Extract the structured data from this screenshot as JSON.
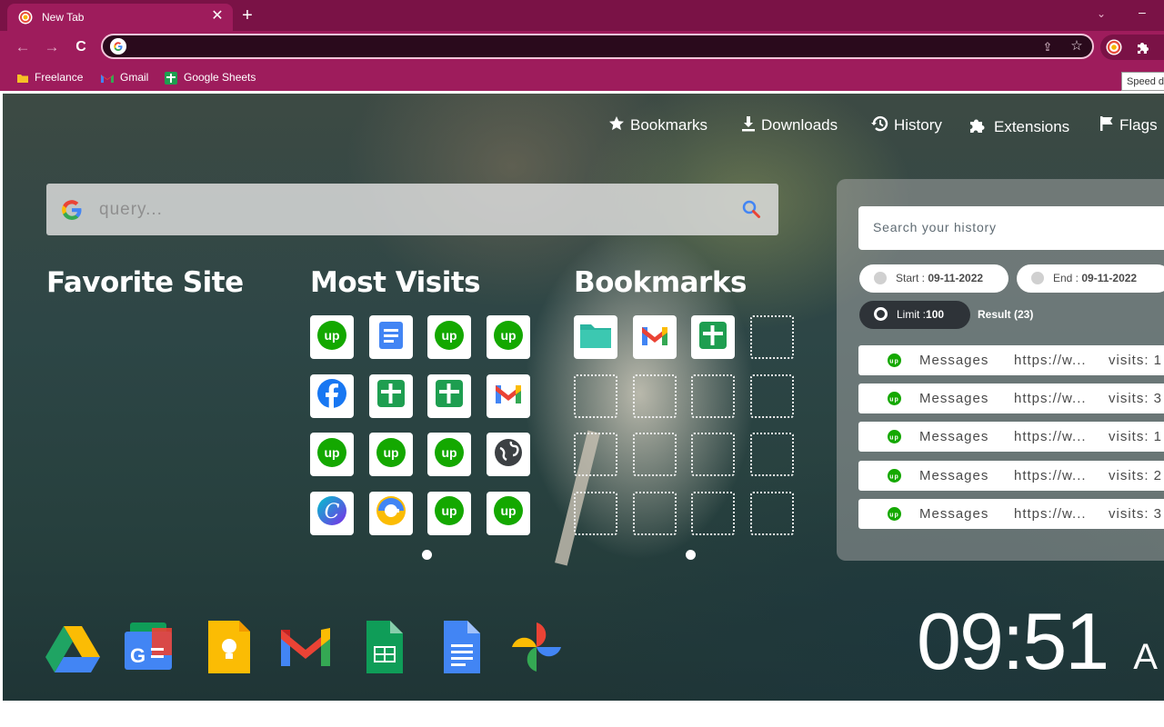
{
  "browser": {
    "tab_title": "New Tab",
    "tab_close": "✕",
    "new_tab": "+",
    "tab_search": "⌄",
    "window_minimize": "–",
    "back": "←",
    "forward": "→",
    "reload": "C",
    "tooltip": "Speed d",
    "bookmarks_bar": [
      {
        "label": "Freelance",
        "icon": "folder-icon"
      },
      {
        "label": "Gmail",
        "icon": "gmail-icon"
      },
      {
        "label": "Google Sheets",
        "icon": "google-sheets-icon"
      }
    ],
    "colors": {
      "frame": "#7a1246",
      "toolbar": "#9e1c5c",
      "omnibox": "#2a0a1c"
    }
  },
  "page": {
    "nav": [
      {
        "label": "Bookmarks",
        "icon": "star-icon"
      },
      {
        "label": "Downloads",
        "icon": "download-icon"
      },
      {
        "label": "History",
        "icon": "history-icon"
      },
      {
        "label": "Extensions",
        "icon": "puzzle-icon"
      },
      {
        "label": "Flags",
        "icon": "flag-icon"
      }
    ],
    "search_placeholder": "query...",
    "sections": {
      "favorite": "Favorite Site",
      "most_visits": "Most Visits",
      "bookmarks": "Bookmarks"
    },
    "most_visits_tiles": [
      [
        "upwork-icon",
        "google-docs-icon",
        "upwork-icon",
        "upwork-icon"
      ],
      [
        "facebook-icon",
        "google-sheets-icon",
        "google-sheets-icon",
        "gmail-icon"
      ],
      [
        "upwork-icon",
        "upwork-icon",
        "upwork-icon",
        "globe-icon"
      ],
      [
        "canva-icon",
        "grammarly-icon",
        "upwork-icon",
        "upwork-icon"
      ]
    ],
    "bookmark_tiles": [
      "folder-icon",
      "gmail-icon",
      "google-sheets-icon"
    ],
    "history": {
      "search_placeholder": "Search your history",
      "start_label": "Start :",
      "start_date": "09-11-2022",
      "end_label": "End :",
      "end_date": "09-11-2022",
      "limit_label": "Limit :",
      "limit_value": "100",
      "result_label": "Result (23)",
      "rows": [
        {
          "title": "Messages",
          "url": "https://w...",
          "visits": "visits: 1"
        },
        {
          "title": "Messages",
          "url": "https://w...",
          "visits": "visits: 3"
        },
        {
          "title": "Messages",
          "url": "https://w...",
          "visits": "visits: 1"
        },
        {
          "title": "Messages",
          "url": "https://w...",
          "visits": "visits: 2"
        },
        {
          "title": "Messages",
          "url": "https://w...",
          "visits": "visits: 3"
        }
      ]
    },
    "clock": "09:51",
    "clock_suffix": "A",
    "dock": [
      "google-drive-icon",
      "google-news-icon",
      "google-keep-icon",
      "gmail-icon",
      "google-sheets-icon",
      "google-docs-icon",
      "google-photos-icon"
    ]
  }
}
